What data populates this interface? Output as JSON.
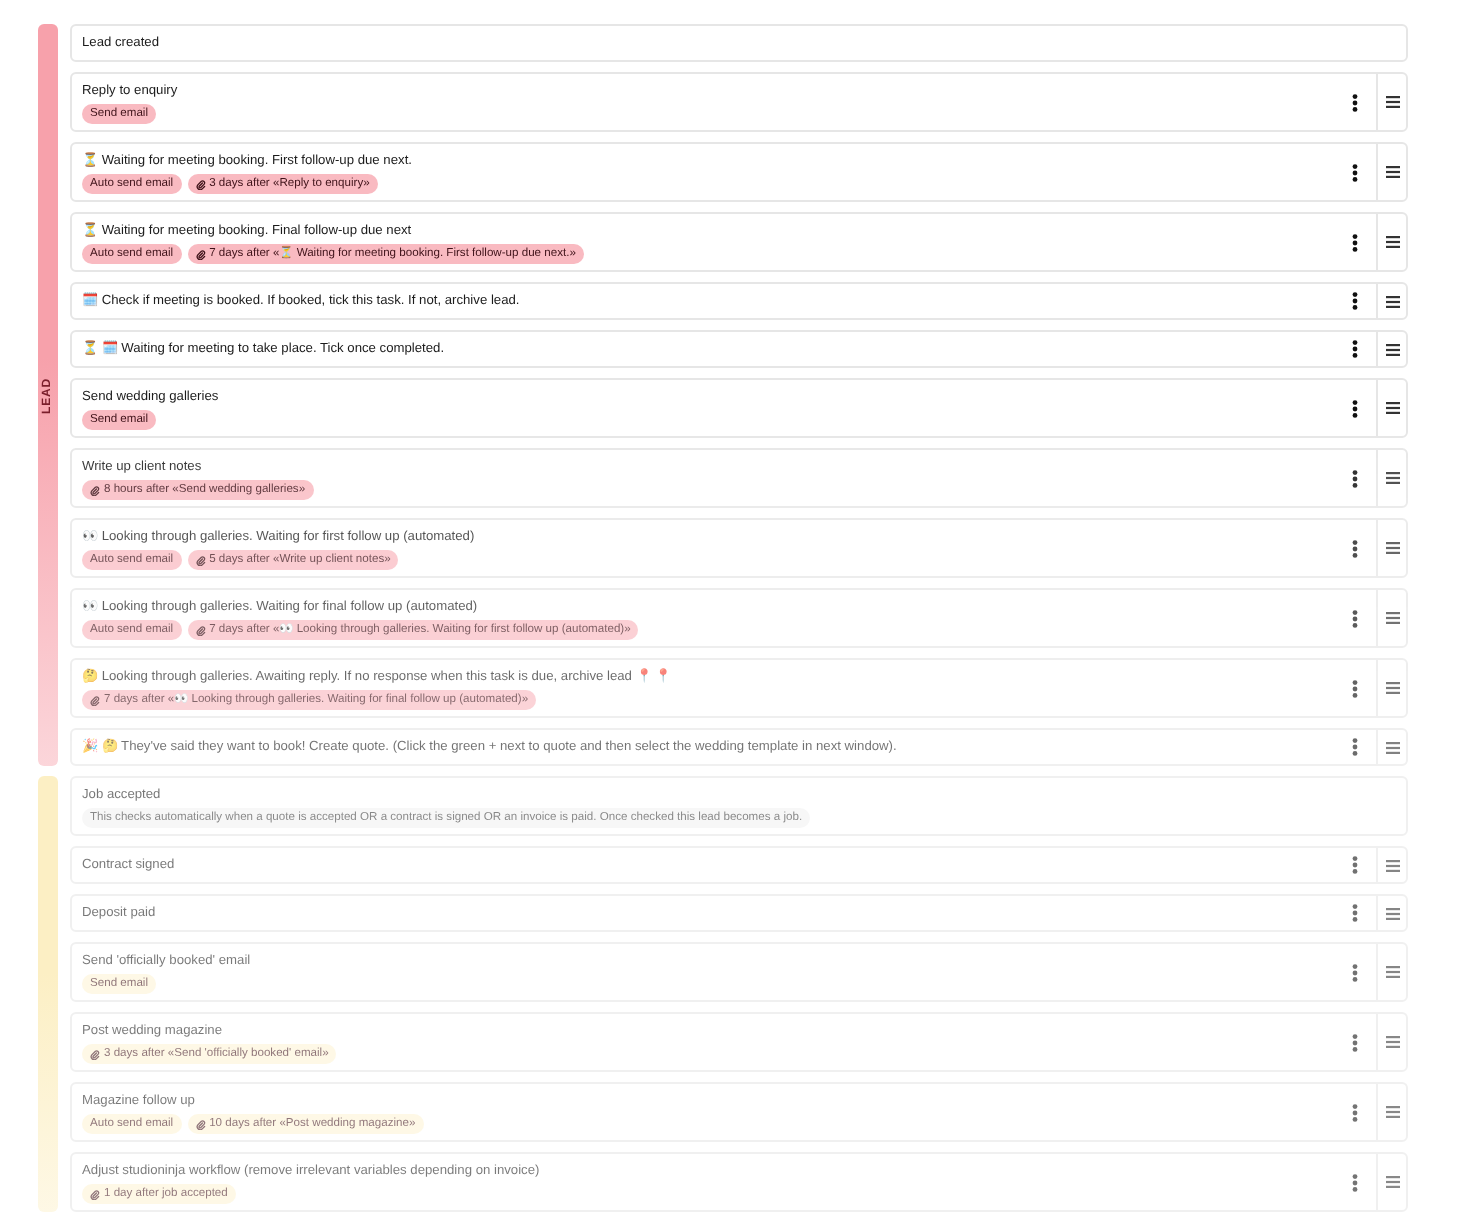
{
  "stages": [
    {
      "label": "LEAD",
      "color": "#f7a1ab",
      "tasks": [
        {
          "kind": "milestone",
          "title": "Lead created"
        },
        {
          "kind": "task",
          "title": "Reply to enquiry",
          "badges": [
            {
              "kind": "action",
              "text": "Send email"
            }
          ]
        },
        {
          "kind": "task",
          "title": "⏳ Waiting for meeting booking. First follow-up due next.",
          "badges": [
            {
              "kind": "action",
              "text": "Auto send email"
            },
            {
              "kind": "delay",
              "text": "3 days after «Reply to enquiry»"
            }
          ]
        },
        {
          "kind": "task",
          "title": "⏳ Waiting for meeting booking. Final follow-up due next",
          "badges": [
            {
              "kind": "action",
              "text": "Auto send email"
            },
            {
              "kind": "delay",
              "text": "7 days after «⏳ Waiting for meeting booking. First follow-up due next.»"
            }
          ]
        },
        {
          "kind": "task",
          "title": "🗓️ Check if meeting is booked. If booked, tick this task. If not, archive lead."
        },
        {
          "kind": "task",
          "title": "⏳ 🗓️ Waiting for meeting to take place. Tick once completed."
        },
        {
          "kind": "task",
          "title": "Send wedding galleries",
          "badges": [
            {
              "kind": "action",
              "text": "Send email"
            }
          ]
        },
        {
          "kind": "task",
          "title": "Write up client notes",
          "badges": [
            {
              "kind": "delay",
              "text": "8 hours after «Send wedding galleries»"
            }
          ]
        },
        {
          "kind": "task",
          "title": "👀 Looking through galleries. Waiting for first follow up (automated)",
          "badges": [
            {
              "kind": "action",
              "text": "Auto send email"
            },
            {
              "kind": "delay",
              "text": "5 days after «Write up client notes»"
            }
          ]
        },
        {
          "kind": "task",
          "title": "👀 Looking through galleries. Waiting for final follow up (automated)",
          "badges": [
            {
              "kind": "action",
              "text": "Auto send email"
            },
            {
              "kind": "delay",
              "text": "7 days after «👀 Looking through galleries. Waiting for first follow up (automated)»"
            }
          ]
        },
        {
          "kind": "task",
          "title": "🤔 Looking through galleries. Awaiting reply. If no response when this task is due, archive lead 📍 📍",
          "badges": [
            {
              "kind": "delay",
              "text": "7 days after «👀 Looking through galleries. Waiting for final follow up (automated)»"
            }
          ]
        },
        {
          "kind": "task",
          "title": "🎉 🤔 They've said they want to book! Create quote. (Click the green + next to quote and then select the wedding template in next window)."
        }
      ]
    },
    {
      "color": "#fcefc4",
      "tasks": [
        {
          "kind": "milestone",
          "title": "Job accepted",
          "badges": [
            {
              "kind": "note",
              "text": "This checks automatically when a quote is accepted OR a contract is signed OR an invoice is paid. Once checked this lead becomes a job."
            }
          ]
        },
        {
          "kind": "task",
          "title": "Contract signed"
        },
        {
          "kind": "task",
          "title": "Deposit paid"
        },
        {
          "kind": "task",
          "title": "Send 'officially booked' email",
          "badges": [
            {
              "kind": "action",
              "text": "Send email"
            }
          ]
        },
        {
          "kind": "task",
          "title": "Post wedding magazine",
          "badges": [
            {
              "kind": "delay",
              "text": "3 days after «Send 'officially booked' email»"
            }
          ]
        },
        {
          "kind": "task",
          "title": "Magazine follow up",
          "badges": [
            {
              "kind": "action",
              "text": "Auto send email"
            },
            {
              "kind": "delay",
              "text": "10 days after «Post wedding magazine»"
            }
          ]
        },
        {
          "kind": "task",
          "title": "Adjust studioninja workflow (remove irrelevant variables depending on invoice)",
          "badges": [
            {
              "kind": "delay",
              "text": "1 day after job accepted"
            }
          ]
        }
      ]
    }
  ]
}
